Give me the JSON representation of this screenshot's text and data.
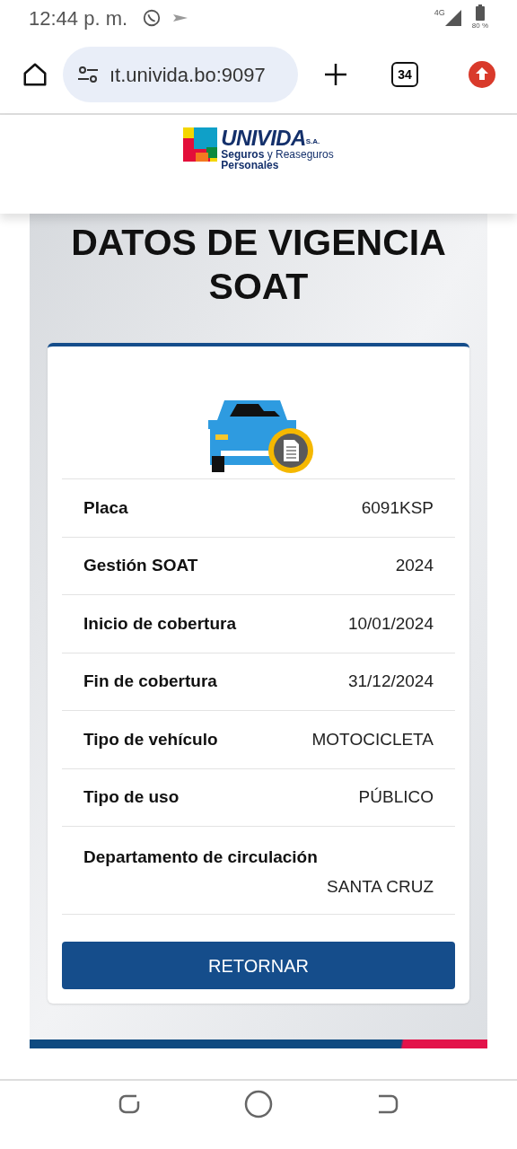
{
  "status_bar": {
    "time": "12:44 p. m.",
    "network": "4G",
    "battery": "80 %"
  },
  "browser": {
    "url": "ıt.univida.bo:9097",
    "tab_count": "34"
  },
  "logo": {
    "name": "UNIVIDA",
    "suffix": "S.A.",
    "tagline": "**Seguros** y Reaseguros",
    "tagline2": "Personales"
  },
  "title": "DATOS DE VIGENCIA SOAT",
  "rows": [
    {
      "kind": "inline",
      "label": "Placa",
      "value": "6091KSP"
    },
    {
      "kind": "inline",
      "label": "Gestión SOAT",
      "value": "2024"
    },
    {
      "kind": "inline",
      "label": "Inicio de cobertura",
      "value": "10/01/2024"
    },
    {
      "kind": "inline",
      "label": "Fin de cobertura",
      "value": "31/12/2024"
    },
    {
      "kind": "inline",
      "label": "Tipo de vehículo",
      "value": "MOTOCICLETA"
    },
    {
      "kind": "inline",
      "label": "Tipo de uso",
      "value": "PÚBLICO"
    },
    {
      "kind": "stacked",
      "label": "Departamento de circulación",
      "value": "SANTA CRUZ"
    }
  ],
  "button": "RETORNAR"
}
